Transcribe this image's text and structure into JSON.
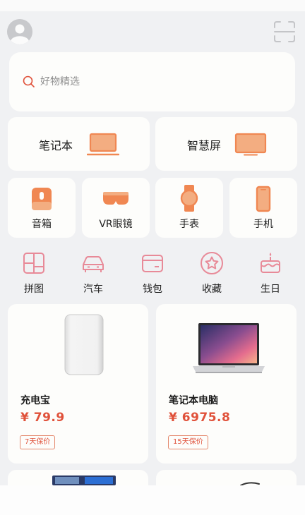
{
  "search": {
    "placeholder": "好物精选"
  },
  "featured": [
    {
      "label": "笔记本",
      "icon": "laptop-icon"
    },
    {
      "label": "智慧屏",
      "icon": "smart-screen-icon"
    }
  ],
  "devices": [
    {
      "label": "音箱",
      "icon": "speaker-icon"
    },
    {
      "label": "VR眼镜",
      "icon": "vr-glasses-icon"
    },
    {
      "label": "手表",
      "icon": "watch-icon"
    },
    {
      "label": "手机",
      "icon": "phone-icon"
    }
  ],
  "quick_links": [
    {
      "label": "拼图",
      "icon": "puzzle-icon"
    },
    {
      "label": "汽车",
      "icon": "car-icon"
    },
    {
      "label": "钱包",
      "icon": "wallet-icon"
    },
    {
      "label": "收藏",
      "icon": "star-icon"
    },
    {
      "label": "生日",
      "icon": "cake-icon"
    }
  ],
  "products": [
    {
      "name": "充电宝",
      "price": "¥ 79.9",
      "tag": "7天保价",
      "image": "power-bank-image"
    },
    {
      "name": "笔记本电脑",
      "price": "¥ 6975.8",
      "tag": "15天保价",
      "image": "laptop-image"
    }
  ],
  "colors": {
    "accent": "#e0513a",
    "icon_orange": "#f08752",
    "icon_fill": "#f3ad81",
    "quick_icon": "#e88a98",
    "background": "#f0f1f3",
    "card": "#fdfdfb"
  }
}
